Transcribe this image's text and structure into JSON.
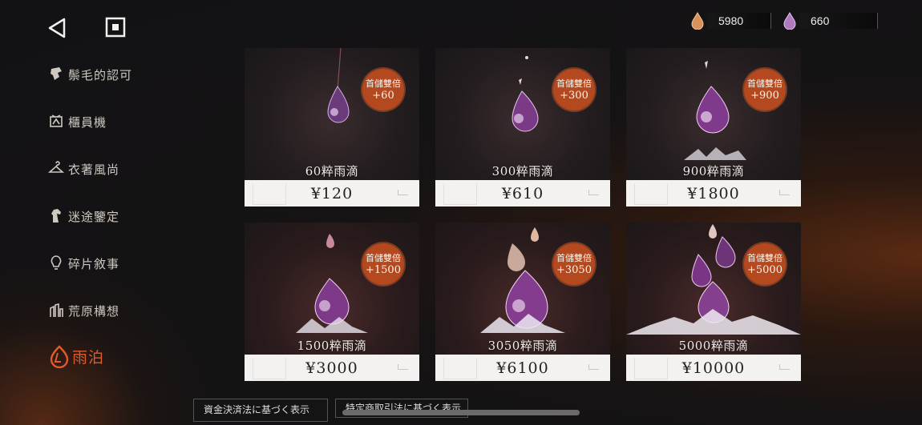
{
  "header": {
    "currencies": [
      {
        "icon": "orange-drop-icon",
        "value": "5980",
        "color": "#d8925a"
      },
      {
        "icon": "purple-drop-icon",
        "value": "660",
        "color": "#b07ac0"
      }
    ]
  },
  "sidebar": {
    "items": [
      {
        "label": "鬃毛的認可",
        "icon": "horse-mane-icon"
      },
      {
        "label": "櫃員機",
        "icon": "atm-icon"
      },
      {
        "label": "衣著風尚",
        "icon": "hanger-icon"
      },
      {
        "label": "迷途鑒定",
        "icon": "horse-head-icon"
      },
      {
        "label": "碎片敘事",
        "icon": "lightbulb-icon"
      },
      {
        "label": "荒原構想",
        "icon": "building-icon"
      },
      {
        "label": "雨泊",
        "icon": "raindrop-logo-icon",
        "active": true
      }
    ]
  },
  "shop": {
    "badge_title": "首儲雙倍",
    "items": [
      {
        "name": "60粹雨滴",
        "price": "¥120",
        "bonus": "+60"
      },
      {
        "name": "300粹雨滴",
        "price": "¥610",
        "bonus": "+300"
      },
      {
        "name": "900粹雨滴",
        "price": "¥1800",
        "bonus": "+900"
      },
      {
        "name": "1500粹雨滴",
        "price": "¥3000",
        "bonus": "+1500"
      },
      {
        "name": "3050粹雨滴",
        "price": "¥6100",
        "bonus": "+3050"
      },
      {
        "name": "5000粹雨滴",
        "price": "¥10000",
        "bonus": "+5000"
      }
    ]
  },
  "footer": {
    "legal_1": "資金決済法に基づく表示",
    "legal_2": "特定商取引法に基づく表示"
  },
  "colors": {
    "accent": "#e35a2a",
    "badge": "#b4481e",
    "price_bg": "#f3f2f0"
  }
}
